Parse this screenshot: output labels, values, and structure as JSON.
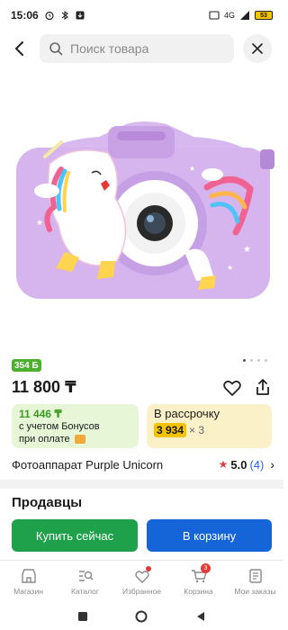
{
  "status_bar": {
    "time": "15:06",
    "network": "4G",
    "battery": "53"
  },
  "search": {
    "placeholder": "Поиск товара"
  },
  "product": {
    "bonus_badge": "354 Б",
    "price": "11 800 ₸",
    "title": "Фотоаппарат Purple Unicorn",
    "rating": "5.0",
    "reviews": "(4)",
    "image_pages": 4
  },
  "bonus_card": {
    "amount": "11 446 ₸",
    "line1": "с учетом Бонусов",
    "line2": "при оплате"
  },
  "installment_card": {
    "title": "В рассрочку",
    "amount": "3 934",
    "multiplier": "× 3"
  },
  "sellers": {
    "title": "Продавцы"
  },
  "actions": {
    "buy": "Купить сейчас",
    "cart": "В корзину"
  },
  "bottom_nav": [
    {
      "label": "Магазин",
      "icon": "store-icon"
    },
    {
      "label": "Каталог",
      "icon": "catalog-icon"
    },
    {
      "label": "Избранное",
      "icon": "heart-icon"
    },
    {
      "label": "Корзина",
      "icon": "cart-icon",
      "badge": "3"
    },
    {
      "label": "Мои заказы",
      "icon": "orders-icon"
    }
  ],
  "colors": {
    "green": "#1fa04a",
    "blue": "#1565d8",
    "accent_red": "#e53935",
    "yellow": "#f5c300"
  }
}
